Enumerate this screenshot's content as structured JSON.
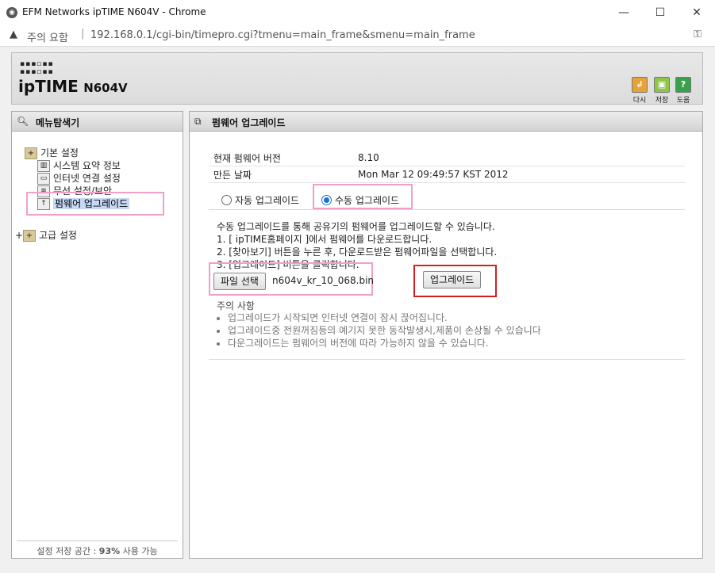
{
  "window": {
    "title": "EFM Networks ipTIME N604V - Chrome",
    "minimize": "—",
    "maximize": "☐",
    "close": "✕"
  },
  "address": {
    "security_label": "주의 요함",
    "separator": "|",
    "url": "192.168.0.1/cgi-bin/timepro.cgi?tmenu=main_frame&smenu=main_frame"
  },
  "header": {
    "logo_text": "ipTIME",
    "model": "N604V",
    "buttons": [
      {
        "label": "다시",
        "icon": "back-icon",
        "color": "#e8a23a"
      },
      {
        "label": "저장",
        "icon": "save-icon",
        "color": "#8ec64a"
      },
      {
        "label": "도움",
        "icon": "help-icon",
        "color": "#3aa04a"
      }
    ]
  },
  "sidebar": {
    "title": "메뉴탐색기",
    "groups": [
      {
        "label": "기본 설정",
        "items": [
          {
            "label": "시스템 요약 정보"
          },
          {
            "label": "인터넷 연결 설정"
          },
          {
            "label": "무선 설정/보안"
          },
          {
            "label": "펌웨어 업그레이드"
          }
        ]
      },
      {
        "expander": "+",
        "label": "고급 설정"
      }
    ],
    "storage": {
      "prefix": "설정 저장 공간 : ",
      "value": "93%",
      "suffix": " 사용 가능"
    }
  },
  "main": {
    "title": "펌웨어 업그레이드",
    "info": [
      {
        "key": "현재 펌웨어 버전",
        "value": "8.10"
      },
      {
        "key": "만든 날짜",
        "value": "Mon Mar 12 09:49:57 KST 2012"
      }
    ],
    "modes": {
      "auto": "자동 업그레이드",
      "manual": "수동 업그레이드",
      "selected": "manual"
    },
    "description": [
      "수동 업그레이드를 통해 공유기의 펌웨어를 업그레이드할 수 있습니다.",
      "1. [ ipTIME홈페이지 ]에서 펌웨어를 다운로드합니다.",
      "2. [찾아보기] 버튼을 누른 후, 다운로드받은 펌웨어파일을 선택합니다.",
      "3. [업그레이드] 버튼을 클릭합니다."
    ],
    "file_button": "파일 선택",
    "file_name": "n604v_kr_10_068.bin",
    "upgrade_button": "업그레이드",
    "caution_title": "주의 사항",
    "cautions": [
      "업그레이드가 시작되면 인터넷 연결이 잠시 끊어집니다.",
      "업그레이드중 전원꺼짐등의 예기지 못한 동작발생시,제품이 손상될 수 있습니다",
      "다운그레이드는 펌웨어의 버전에 따라 가능하지 않을 수 있습니다."
    ]
  }
}
